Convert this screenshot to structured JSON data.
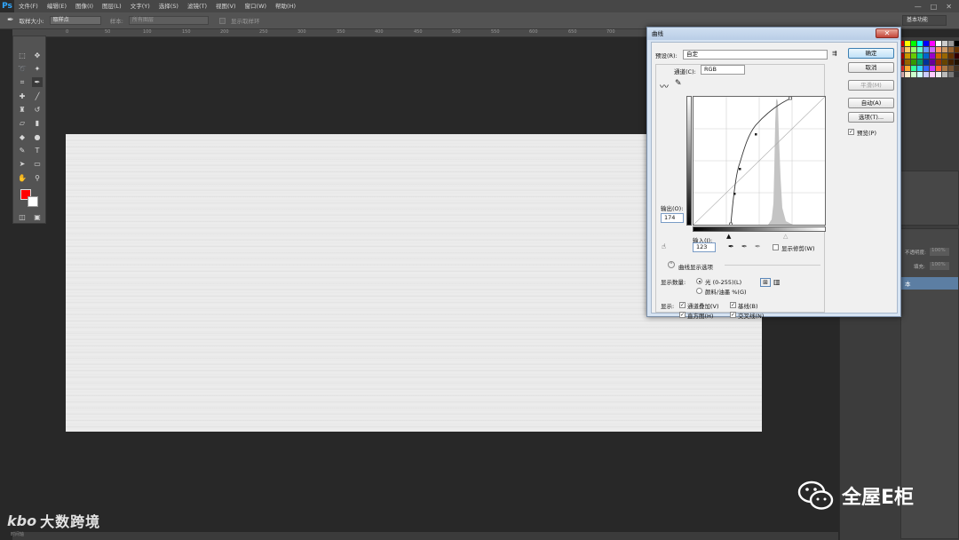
{
  "app": {
    "logo": "Ps"
  },
  "menu": [
    "文件(F)",
    "编辑(E)",
    "图像(I)",
    "图层(L)",
    "文字(Y)",
    "选择(S)",
    "滤镜(T)",
    "视图(V)",
    "窗口(W)",
    "帮助(H)"
  ],
  "window_controls": [
    "—",
    "□",
    "✕"
  ],
  "options_bar": {
    "sample_size_label": "取样大小:",
    "sample_size_value": "取样点",
    "sample_label": "样本:",
    "sample_value": "所有图层",
    "show_ring_label": "显示取样环"
  },
  "workspace": {
    "value": "基本功能"
  },
  "ruler_ticks": [
    "0",
    "50",
    "100",
    "150",
    "200",
    "250",
    "300",
    "350",
    "400",
    "450",
    "500",
    "550",
    "600",
    "650",
    "700"
  ],
  "dialog": {
    "title": "曲线",
    "close_glyph": "✕",
    "preset_label": "预设(R):",
    "preset_value": "自定",
    "channel_label": "通道(C):",
    "channel_value": "RGB",
    "output_label": "输出(O):",
    "output_value": "174",
    "input_label": "输入(I):",
    "input_value": "123",
    "show_clipping_label": "显示修剪(W)",
    "curve_options_label": "曲线显示选项",
    "show_amount_label": "显示数量:",
    "light_label": "光 (0-255)(L)",
    "pigment_label": "颜料/油墨 %(G)",
    "show_label": "显示:",
    "channel_overlay_label": "通道叠加(V)",
    "baseline_label": "基线(B)",
    "histogram_label": "直方图(H)",
    "intersection_label": "交叉线(N)",
    "ok_label": "确定",
    "cancel_label": "取消",
    "smooth_label": "平滑(M)",
    "auto_label": "自动(A)",
    "options_label": "选项(T)...",
    "preview_label": "预览(P)",
    "preview_checked": true,
    "overlay_checked": true,
    "baseline_checked": true,
    "histogram_checked": true,
    "intersection_checked": true
  },
  "layers_panel": {
    "opacity_label": "不透明度:",
    "opacity_value": "100%",
    "fill_label": "填充:",
    "fill_value": "100%",
    "layer_name": "本"
  },
  "branding": {
    "left_logo": "kbo",
    "left_text": "大数跨境",
    "left_sub": "时间轴",
    "watermark": "全屋E柜"
  },
  "colors": {
    "foreground": "#ff0000",
    "background": "#ffffff",
    "dialog_bg": "#f0f0f0"
  },
  "swatch_colors": [
    "#ff0000",
    "#ffff00",
    "#00ff00",
    "#00ffff",
    "#0000ff",
    "#ff00ff",
    "#ffffff",
    "#cccccc",
    "#999999",
    "#000000",
    "#ff6666",
    "#ffcc66",
    "#99ff66",
    "#66ffcc",
    "#6699ff",
    "#cc66ff",
    "#ff9966",
    "#cc9966",
    "#996633",
    "#663300",
    "#cc0000",
    "#cc9900",
    "#66cc00",
    "#00cc99",
    "#0066cc",
    "#9900cc",
    "#cc6600",
    "#996600",
    "#663300",
    "#330000",
    "#990000",
    "#996600",
    "#339900",
    "#009966",
    "#003399",
    "#660099",
    "#993300",
    "#664400",
    "#442200",
    "#221100",
    "#ff3333",
    "#ffaa33",
    "#33ff99",
    "#33ccff",
    "#3366ff",
    "#cc33ff",
    "#ff6633",
    "#aa7744",
    "#775533",
    "#443322",
    "#ffcccc",
    "#ffeecc",
    "#ccffcc",
    "#ccffff",
    "#ccccff",
    "#ffccff",
    "#eeeeee",
    "#bbbbbb",
    "#777777",
    "#333333"
  ]
}
